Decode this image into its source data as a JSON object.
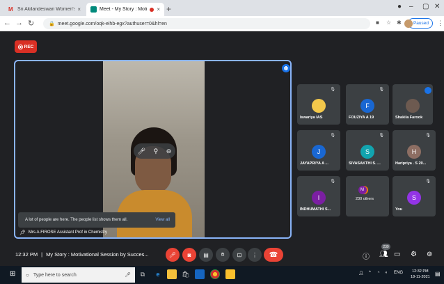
{
  "browser": {
    "tabs": [
      {
        "title": "Sri Akilandeswari Women's Colle",
        "favicon": "gmail-icon",
        "color": "#d93025"
      },
      {
        "title": "Meet - My Story : Motivatio",
        "favicon": "meet-icon",
        "color": "#00897b"
      }
    ],
    "new_tab_label": "+",
    "url": "meet.google.com/oqk-eihb-egx?authuser=0&hl=en",
    "paused_label": "Paused"
  },
  "recording": {
    "label": "REC",
    "color": "#d93025"
  },
  "main_speaker": {
    "name": "Mrs.A.FIROSE Assistant Prof in Chemistry",
    "toast_text": "A lot of people are here. The people list shows them all.",
    "toast_action": "View all"
  },
  "participants": [
    {
      "name": "Iswariya IAS",
      "avatar": "",
      "avatar_color": "#f3c84b",
      "muted": true
    },
    {
      "name": "FOUZIYA A 19",
      "avatar": "F",
      "avatar_color": "#1967d2",
      "muted": true
    },
    {
      "name": "Shakila Farook",
      "avatar": "",
      "avatar_color": "#6d5a50",
      "muted": false
    },
    {
      "name": "JAYAPRIYA A ...",
      "avatar": "J",
      "avatar_color": "#1967d2",
      "muted": true
    },
    {
      "name": "SIVASAKTHI S. ...",
      "avatar": "S",
      "avatar_color": "#12a4af",
      "muted": true
    },
    {
      "name": "Haripriya . S 20...",
      "avatar": "H",
      "avatar_color": "#8d6e63",
      "muted": true
    },
    {
      "name": "INDHUMATHI S...",
      "avatar": "I",
      "avatar_color": "#7b1fa2",
      "muted": true
    },
    {
      "name": "230 others",
      "avatar": "M",
      "avatar_color": "#7b1fa2",
      "muted": false
    },
    {
      "name": "You",
      "avatar": "S",
      "avatar_color": "#9334e6",
      "muted": true
    }
  ],
  "meeting": {
    "time": "12:32 PM",
    "separator": "|",
    "title": "My Story : Motivational Session by Succes...",
    "participant_count": "239"
  },
  "taskbar": {
    "search_placeholder": "Type here to search",
    "language": "ENG",
    "time": "12:32 PM",
    "date": "18-11-2021"
  }
}
